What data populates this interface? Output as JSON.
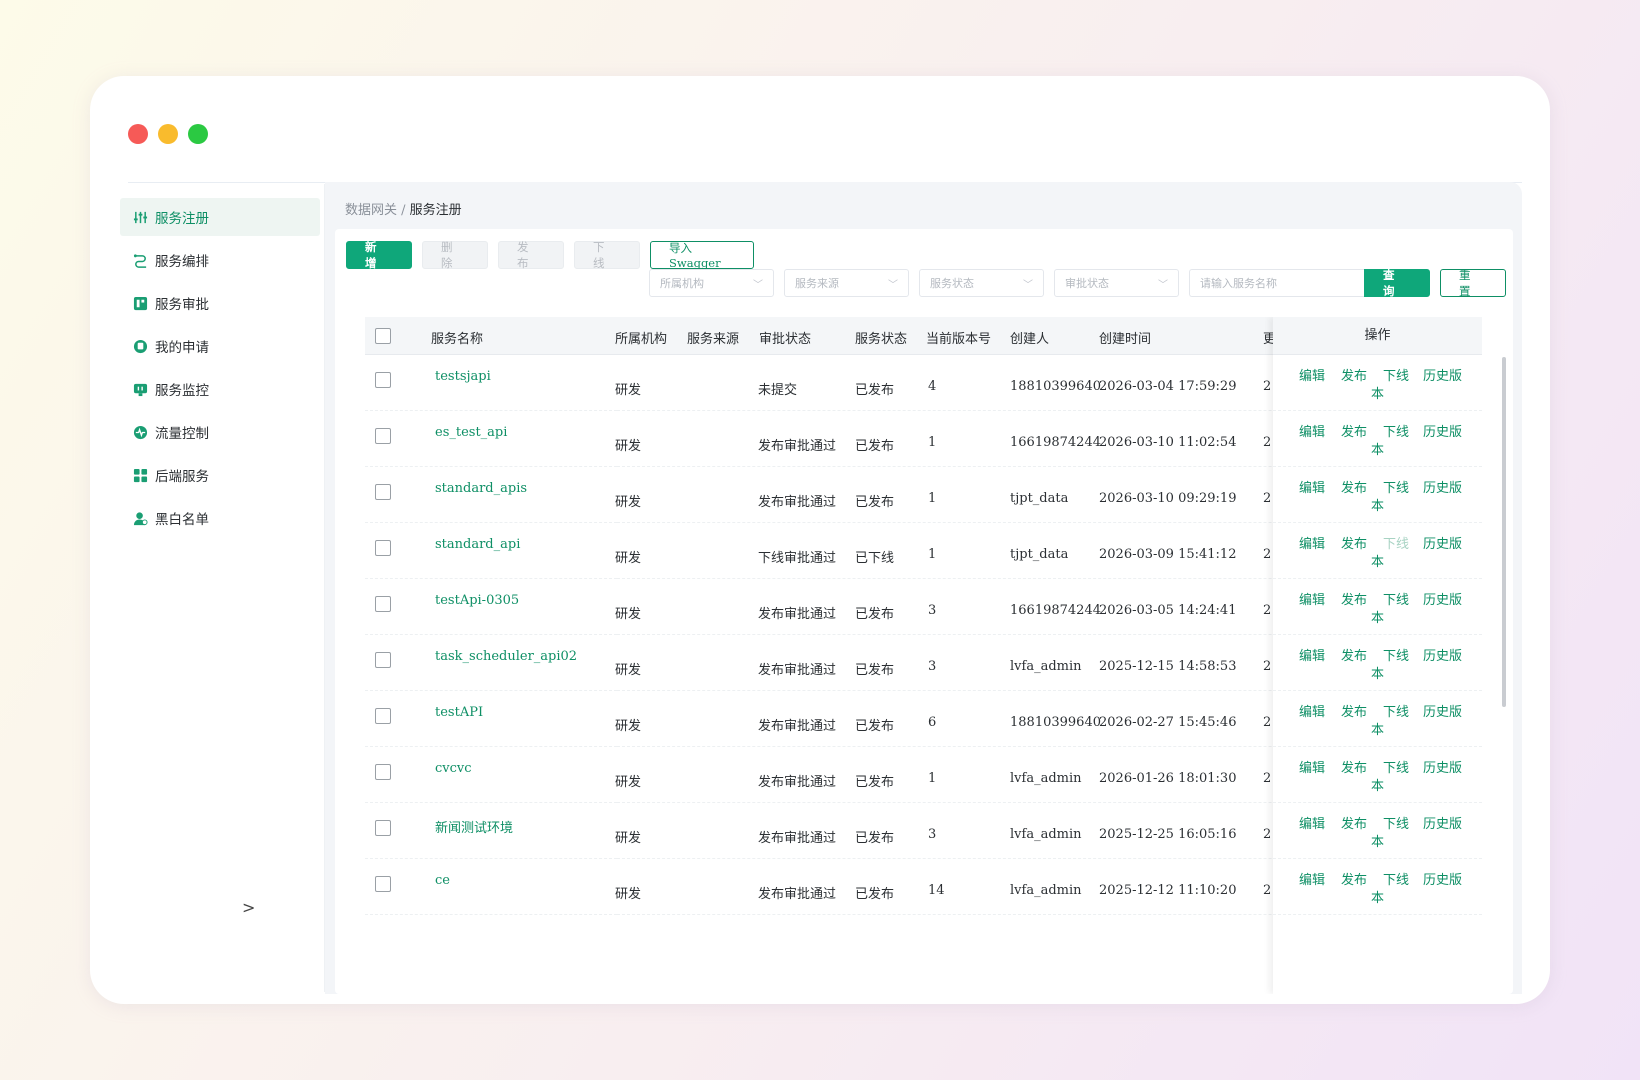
{
  "window": {
    "controls": [
      "close",
      "minimize",
      "maximize"
    ]
  },
  "sidebar": {
    "items": [
      {
        "label": "服务注册",
        "icon": "sliders-icon",
        "active": true
      },
      {
        "label": "服务编排",
        "icon": "flow-icon",
        "active": false
      },
      {
        "label": "服务审批",
        "icon": "approval-icon",
        "active": false
      },
      {
        "label": "我的申请",
        "icon": "application-icon",
        "active": false
      },
      {
        "label": "服务监控",
        "icon": "monitor-icon",
        "active": false
      },
      {
        "label": "流量控制",
        "icon": "traffic-icon",
        "active": false
      },
      {
        "label": "后端服务",
        "icon": "grid-icon",
        "active": false
      },
      {
        "label": "黑白名单",
        "icon": "user-list-icon",
        "active": false
      }
    ],
    "collapse_label": ">"
  },
  "breadcrumb": {
    "parent": "数据网关",
    "separator": " / ",
    "current": "服务注册"
  },
  "toolbar": {
    "add_label": "新 增",
    "delete_label": "删 除",
    "publish_label": "发 布",
    "offline_label": "下 线",
    "import_label": "导入Swagger"
  },
  "filters": {
    "org_placeholder": "所属机构",
    "source_placeholder": "服务来源",
    "status_placeholder": "服务状态",
    "approval_placeholder": "审批状态",
    "search_placeholder": "请输入服务名称",
    "search_label": "查 询",
    "reset_label": "重 置"
  },
  "table": {
    "columns": [
      "服务名称",
      "所属机构",
      "服务来源",
      "审批状态",
      "服务状态",
      "当前版本号",
      "创建人",
      "创建时间",
      "操作"
    ],
    "truncated_header": "更",
    "truncated_cell": "2",
    "actions": {
      "edit": "编辑",
      "publish": "发布",
      "offline": "下线",
      "history_1": "历史版",
      "history_2": "本"
    },
    "rows": [
      {
        "name": "testsjapi",
        "org": "研发",
        "source": "",
        "approval": "未提交",
        "status": "已发布",
        "version": "4",
        "creator": "18810399640",
        "created": "2026-03-04 17:59:29",
        "offline_disabled": false
      },
      {
        "name": "es_test_api",
        "org": "研发",
        "source": "",
        "approval": "发布审批通过",
        "status": "已发布",
        "version": "1",
        "creator": "16619874244",
        "created": "2026-03-10 11:02:54",
        "offline_disabled": false
      },
      {
        "name": "standard_apis",
        "org": "研发",
        "source": "",
        "approval": "发布审批通过",
        "status": "已发布",
        "version": "1",
        "creator": "tjpt_data",
        "created": "2026-03-10 09:29:19",
        "offline_disabled": false
      },
      {
        "name": "standard_api",
        "org": "研发",
        "source": "",
        "approval": "下线审批通过",
        "status": "已下线",
        "version": "1",
        "creator": "tjpt_data",
        "created": "2026-03-09 15:41:12",
        "offline_disabled": true
      },
      {
        "name": "testApi-0305",
        "org": "研发",
        "source": "",
        "approval": "发布审批通过",
        "status": "已发布",
        "version": "3",
        "creator": "16619874244",
        "created": "2026-03-05 14:24:41",
        "offline_disabled": false
      },
      {
        "name": "task_scheduler_api02",
        "org": "研发",
        "source": "",
        "approval": "发布审批通过",
        "status": "已发布",
        "version": "3",
        "creator": "lvfa_admin",
        "created": "2025-12-15 14:58:53",
        "offline_disabled": false
      },
      {
        "name": "testAPI",
        "org": "研发",
        "source": "",
        "approval": "发布审批通过",
        "status": "已发布",
        "version": "6",
        "creator": "18810399640",
        "created": "2026-02-27 15:45:46",
        "offline_disabled": false
      },
      {
        "name": "cvcvc",
        "org": "研发",
        "source": "",
        "approval": "发布审批通过",
        "status": "已发布",
        "version": "1",
        "creator": "lvfa_admin",
        "created": "2026-01-26 18:01:30",
        "offline_disabled": false
      },
      {
        "name": "新闻测试环境",
        "org": "研发",
        "source": "",
        "approval": "发布审批通过",
        "status": "已发布",
        "version": "3",
        "creator": "lvfa_admin",
        "created": "2025-12-25 16:05:16",
        "offline_disabled": false
      },
      {
        "name": "ce",
        "org": "研发",
        "source": "",
        "approval": "发布审批通过",
        "status": "已发布",
        "version": "14",
        "creator": "lvfa_admin",
        "created": "2025-12-12 11:10:20",
        "offline_disabled": false
      }
    ]
  },
  "colors": {
    "accent": "#0fa77a",
    "link": "#0e8f65",
    "disabled_link": "#a8d3c3"
  }
}
